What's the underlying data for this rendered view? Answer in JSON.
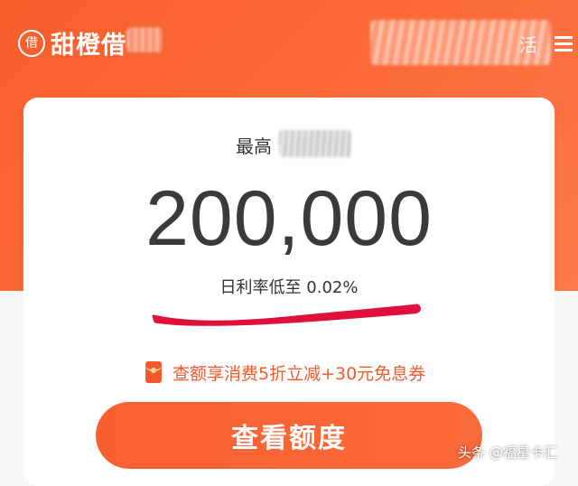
{
  "header": {
    "app_name": "甜橙借",
    "logo_glyph": "借",
    "right_text": "活"
  },
  "card": {
    "subtitle": "最高",
    "amount": "200,000",
    "rate_text": "日利率低至 0.02%",
    "promo_text": "查额享消费5折立减+30元免息券",
    "cta_label": "查看额度"
  },
  "watermark": "头条 @福星卡汇",
  "colors": {
    "brand": "#f85f2c",
    "accent_text": "#f75a2a",
    "annotation_stroke": "#e0103c"
  }
}
